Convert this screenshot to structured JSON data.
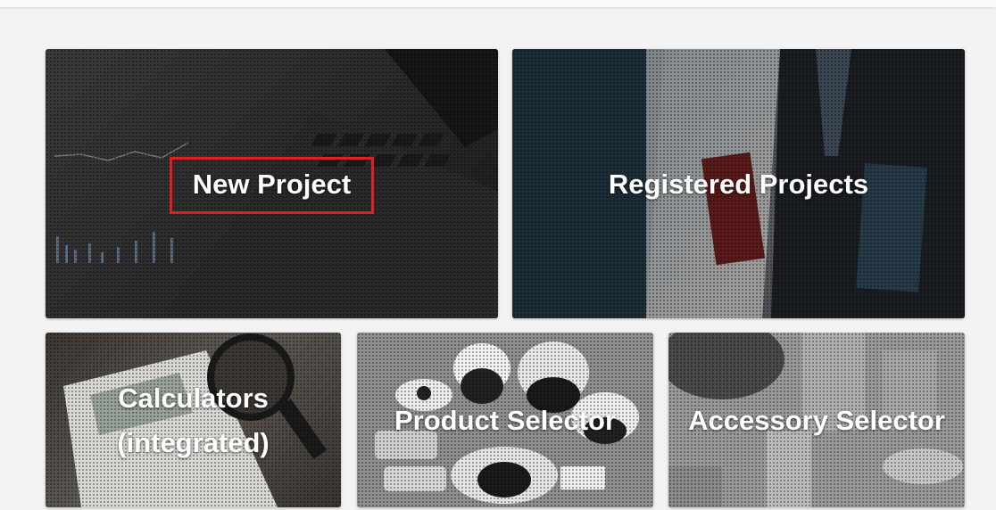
{
  "tiles": {
    "new_project": {
      "label": "New Project"
    },
    "registered_projects": {
      "label": "Registered Projects"
    },
    "calculators": {
      "line1": "Calculators",
      "line2": "(integrated)"
    },
    "product_selector": {
      "label": "Product Selector"
    },
    "accessory_selector": {
      "label": "Accessory Selector"
    }
  },
  "colors": {
    "highlight": "#e02020",
    "background": "#f3f3f3"
  }
}
